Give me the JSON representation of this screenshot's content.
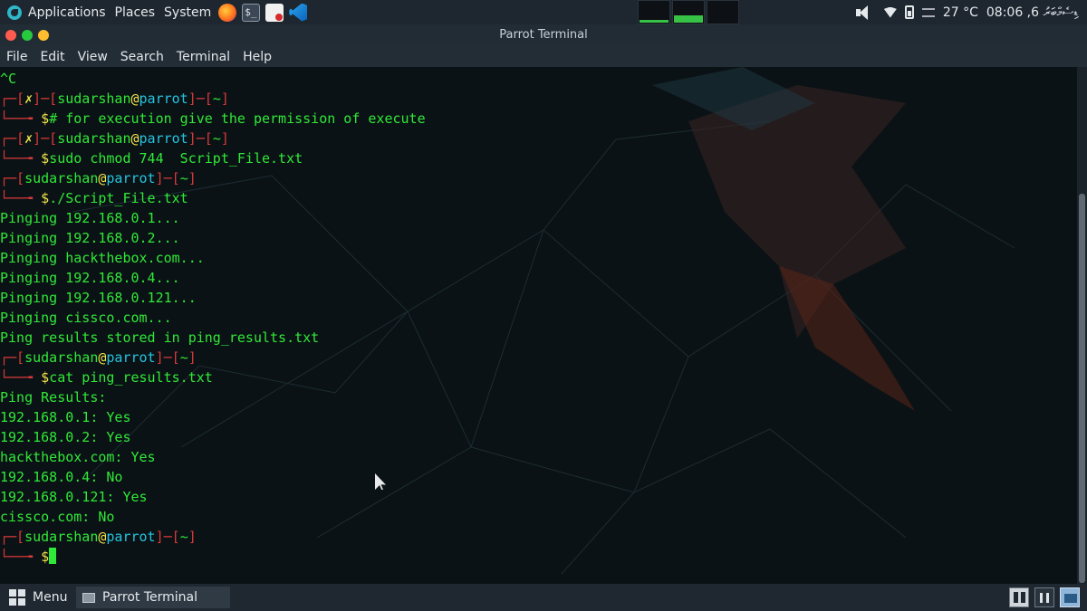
{
  "top_panel": {
    "menus": [
      "Applications",
      "Places",
      "System"
    ],
    "launchers": [
      "firefox-icon",
      "terminal-icon",
      "document-icon",
      "vscode-icon"
    ],
    "terminal_glyph": "$_",
    "temperature": "27 °C",
    "clock": "08:06 ,6 ޑިސެމްބަރު"
  },
  "window": {
    "title": "Parrot Terminal",
    "menu": [
      "File",
      "Edit",
      "View",
      "Search",
      "Terminal",
      "Help"
    ]
  },
  "terminal": {
    "lines": [
      [
        {
          "t": "^C",
          "c": "grn"
        }
      ],
      [
        {
          "t": "┌─[",
          "c": "red"
        },
        {
          "t": "✗",
          "c": "x"
        },
        {
          "t": "]─[",
          "c": "red"
        },
        {
          "t": "sudarshan",
          "c": "grn"
        },
        {
          "t": "@",
          "c": "yel"
        },
        {
          "t": "parrot",
          "c": "cyn"
        },
        {
          "t": "]─[",
          "c": "red"
        },
        {
          "t": "~",
          "c": "grn"
        },
        {
          "t": "]",
          "c": "red"
        }
      ],
      [
        {
          "t": "└──╼ ",
          "c": "red"
        },
        {
          "t": "$",
          "c": "yel"
        },
        {
          "t": "# for execution give the permission of execute",
          "c": "grn"
        }
      ],
      [
        {
          "t": "┌─[",
          "c": "red"
        },
        {
          "t": "✗",
          "c": "x"
        },
        {
          "t": "]─[",
          "c": "red"
        },
        {
          "t": "sudarshan",
          "c": "grn"
        },
        {
          "t": "@",
          "c": "yel"
        },
        {
          "t": "parrot",
          "c": "cyn"
        },
        {
          "t": "]─[",
          "c": "red"
        },
        {
          "t": "~",
          "c": "grn"
        },
        {
          "t": "]",
          "c": "red"
        }
      ],
      [
        {
          "t": "└──╼ ",
          "c": "red"
        },
        {
          "t": "$",
          "c": "yel"
        },
        {
          "t": "sudo chmod 744  Script_File.txt",
          "c": "grn"
        }
      ],
      [
        {
          "t": "┌─[",
          "c": "red"
        },
        {
          "t": "sudarshan",
          "c": "grn"
        },
        {
          "t": "@",
          "c": "yel"
        },
        {
          "t": "parrot",
          "c": "cyn"
        },
        {
          "t": "]─[",
          "c": "red"
        },
        {
          "t": "~",
          "c": "grn"
        },
        {
          "t": "]",
          "c": "red"
        }
      ],
      [
        {
          "t": "└──╼ ",
          "c": "red"
        },
        {
          "t": "$",
          "c": "yel"
        },
        {
          "t": "./Script_File.txt",
          "c": "grn"
        }
      ],
      [
        {
          "t": "Pinging 192.168.0.1...",
          "c": "grn"
        }
      ],
      [
        {
          "t": "Pinging 192.168.0.2...",
          "c": "grn"
        }
      ],
      [
        {
          "t": "Pinging hackthebox.com...",
          "c": "grn"
        }
      ],
      [
        {
          "t": "Pinging 192.168.0.4...",
          "c": "grn"
        }
      ],
      [
        {
          "t": "Pinging 192.168.0.121...",
          "c": "grn"
        }
      ],
      [
        {
          "t": "Pinging cissco.com...",
          "c": "grn"
        }
      ],
      [
        {
          "t": "Ping results stored in ping_results.txt",
          "c": "grn"
        }
      ],
      [
        {
          "t": "┌─[",
          "c": "red"
        },
        {
          "t": "sudarshan",
          "c": "grn"
        },
        {
          "t": "@",
          "c": "yel"
        },
        {
          "t": "parrot",
          "c": "cyn"
        },
        {
          "t": "]─[",
          "c": "red"
        },
        {
          "t": "~",
          "c": "grn"
        },
        {
          "t": "]",
          "c": "red"
        }
      ],
      [
        {
          "t": "└──╼ ",
          "c": "red"
        },
        {
          "t": "$",
          "c": "yel"
        },
        {
          "t": "cat ping_results.txt",
          "c": "grn"
        }
      ],
      [
        {
          "t": "Ping Results:",
          "c": "grn"
        }
      ],
      [
        {
          "t": "192.168.0.1: Yes",
          "c": "grn"
        }
      ],
      [
        {
          "t": "192.168.0.2: Yes",
          "c": "grn"
        }
      ],
      [
        {
          "t": "hackthebox.com: Yes",
          "c": "grn"
        }
      ],
      [
        {
          "t": "192.168.0.4: No",
          "c": "grn"
        }
      ],
      [
        {
          "t": "192.168.0.121: Yes",
          "c": "grn"
        }
      ],
      [
        {
          "t": "cissco.com: No",
          "c": "grn"
        }
      ],
      [
        {
          "t": "┌─[",
          "c": "red"
        },
        {
          "t": "sudarshan",
          "c": "grn"
        },
        {
          "t": "@",
          "c": "yel"
        },
        {
          "t": "parrot",
          "c": "cyn"
        },
        {
          "t": "]─[",
          "c": "red"
        },
        {
          "t": "~",
          "c": "grn"
        },
        {
          "t": "]",
          "c": "red"
        }
      ],
      [
        {
          "t": "└──╼ ",
          "c": "red"
        },
        {
          "t": "$",
          "c": "yel"
        },
        {
          "cursor": true
        }
      ]
    ]
  },
  "bottom_panel": {
    "menu_label": "Menu",
    "task_label": "Parrot Terminal",
    "workspaces": [
      "workspace-1",
      "workspace-2",
      "workspace-3"
    ]
  },
  "colors": {
    "prompt_red": "#d63a3a",
    "text_green": "#30e838",
    "host_cyan": "#25c3e0",
    "at_yellow": "#f2e24a"
  }
}
